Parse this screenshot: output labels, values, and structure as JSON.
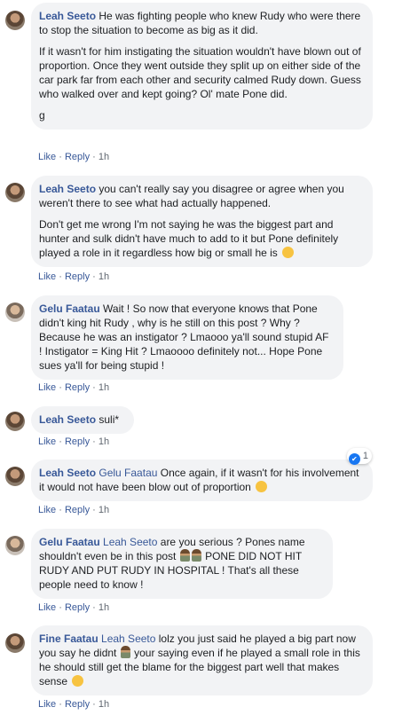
{
  "actions": {
    "like": "Like",
    "reply": "Reply",
    "dot": "·"
  },
  "comments": [
    {
      "author": "Leah Seeto",
      "paragraphs": [
        "He was fighting people who knew Rudy who were there to stop the situation to become as big as it did.",
        "If it wasn't for him instigating the situation wouldn't have blown out of proportion. Once they went outside they split up on either side of the car park far from each other and security calmed Rudy down. Guess who walked over and kept going? Ol' mate Pone did.",
        "g"
      ],
      "time": "1h"
    },
    {
      "author": "Leah Seeto",
      "paragraphs": [
        "you can't really say you disagree or agree when you weren't there to see what had actually happened.",
        "Don't get me wrong I'm not saying he was the biggest part and hunter and sulk didn't have much to add to it but Pone definitely played a role in it regardless how big or small he is"
      ],
      "emoji": "slightly-smiling-face-emoji",
      "time": "1h"
    },
    {
      "author": "Gelu Faatau",
      "paragraphs": [
        "Wait ! So now that everyone knows that Pone didn't king hit Rudy , why is he still on this post ? Why ? Because he was an instigator ? Lmaooo ya'll sound stupid AF ! Instigator = King Hit ? Lmaoooo definitely not... Hope Pone sues ya'll for being stupid !"
      ],
      "time": "1h"
    },
    {
      "author": "Leah Seeto",
      "text": "suli*",
      "time": "1h"
    },
    {
      "author": "Leah Seeto",
      "mention": "Gelu Faatau",
      "text": "Once again, if it wasn't for his involvement it would not have been blow out of proportion",
      "emoji": "slightly-smiling-face-emoji",
      "reaction_count": "1",
      "time": "1h"
    },
    {
      "author": "Gelu Faatau",
      "mention": "Leah Seeto",
      "text_a": "are you serious ? Pones name shouldn't even be in this post",
      "text_b": "PONE DID NOT HIT RUDY AND PUT RUDY IN HOSPITAL ! That's all these people need to know !",
      "emoji": "person-facepalming-emoji",
      "time": "1h"
    },
    {
      "author": "Fine Faatau",
      "mention": "Leah Seeto",
      "text_a": "lolz you just said he played a big part now you say he didnt",
      "text_b": "your saying even if he played a small role in this he should still get the blame for the biggest part well that makes sense",
      "emoji": "unamused-face-emoji",
      "time": "1h"
    }
  ]
}
